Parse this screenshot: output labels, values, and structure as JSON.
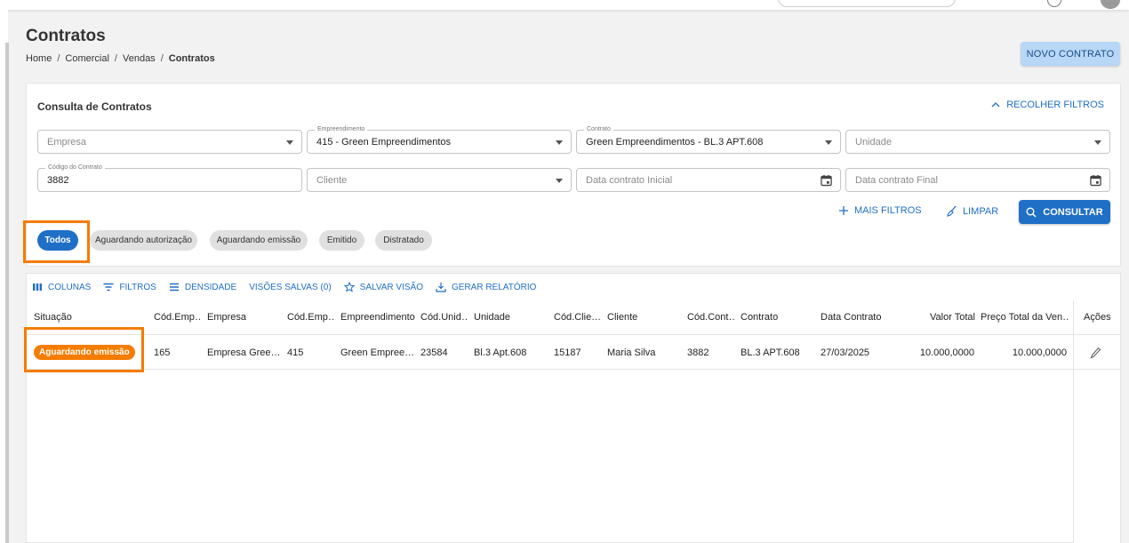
{
  "page": {
    "title": "Contratos",
    "breadcrumb": [
      "Home",
      "Comercial",
      "Vendas",
      "Contratos"
    ]
  },
  "header": {
    "novo_contrato": "NOVO CONTRATO"
  },
  "filters": {
    "title": "Consulta de Contratos",
    "recolher": "RECOLHER FILTROS",
    "empresa": {
      "placeholder": "Empresa"
    },
    "empreendimento": {
      "legend": "Empreendimento",
      "value": "415 - Green Empreendimentos"
    },
    "contrato": {
      "legend": "Contrato",
      "value": "Green Empreendimentos - BL.3 APT.608"
    },
    "unidade": {
      "placeholder": "Unidade"
    },
    "codigo": {
      "legend": "Código do Contrato",
      "value": "3882"
    },
    "cliente": {
      "placeholder": "Cliente"
    },
    "data_inicial": {
      "placeholder": "Data contrato Inicial"
    },
    "data_final": {
      "placeholder": "Data contrato Final"
    },
    "mais_filtros": "MAIS FILTROS",
    "limpar": "LIMPAR",
    "consultar": "CONSULTAR"
  },
  "status_chips": [
    "Todos",
    "Aguardando autorização",
    "Aguardando emissão",
    "Emitido",
    "Distratado"
  ],
  "grid_toolbar": {
    "colunas": "COLUNAS",
    "filtros": "FILTROS",
    "densidade": "DENSIDADE",
    "visoes": "VISÕES SALVAS (0)",
    "salvar": "SALVAR VISÃO",
    "relatorio": "GERAR RELATÓRIO"
  },
  "table": {
    "columns": [
      "Situação",
      "Cód.Emp…",
      "Empresa",
      "Cód.Emp…",
      "Empreendimento",
      "Cód.Unid…",
      "Unidade",
      "Cód.Clie…",
      "Cliente",
      "Cód.Cont…",
      "Contrato",
      "Data Contrato",
      "Valor Total",
      "Preço Total da Ven…",
      "Ações"
    ],
    "rows": [
      {
        "situacao": "Aguardando emissão",
        "cod_empresa": "165",
        "empresa": "Empresa Gree…",
        "cod_empreend": "415",
        "empreendimento": "Green Empree…",
        "cod_unidade": "23584",
        "unidade": "Bl.3 Apt.608",
        "cod_cliente": "15187",
        "cliente": "Maria Silva",
        "cod_contrato": "3882",
        "contrato": "BL.3 APT.608",
        "data": "27/03/2025",
        "valor_total": "10.000,0000",
        "preco_total": "10.000,0000"
      }
    ]
  },
  "colors": {
    "primary": "#1f6fc7",
    "highlight": "#f57c00",
    "status_badge": "#f57c00"
  }
}
